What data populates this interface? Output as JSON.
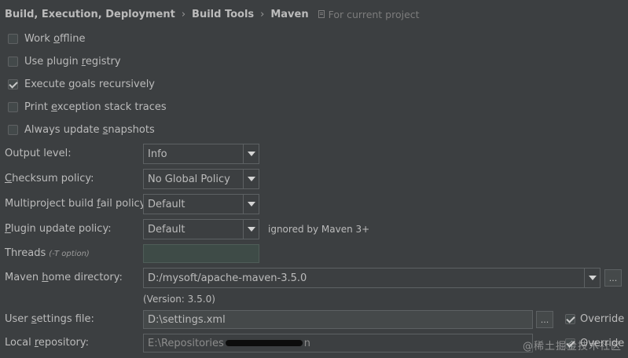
{
  "breadcrumb": {
    "items": [
      "Build, Execution, Deployment",
      "Build Tools",
      "Maven"
    ],
    "separator": "›",
    "scope_label": "For current project",
    "scope_icon": "copy-icon"
  },
  "checkboxes": [
    {
      "pre": "Work ",
      "mnemonic": "o",
      "post": "ffline",
      "checked": false
    },
    {
      "pre": "Use plugin ",
      "mnemonic": "r",
      "post": "egistry",
      "checked": false
    },
    {
      "pre": "Execute ",
      "mnemonic": "g",
      "post": "oals recursively",
      "checked": true
    },
    {
      "pre": "Print ",
      "mnemonic": "e",
      "post": "xception stack traces",
      "checked": false
    },
    {
      "pre": "Always update ",
      "mnemonic": "s",
      "post": "napshots",
      "checked": false
    }
  ],
  "output_level": {
    "label": "Output level:",
    "value": "Info"
  },
  "checksum_policy": {
    "pre": "",
    "mnemonic": "C",
    "post": "hecksum policy:",
    "value": "No Global Policy"
  },
  "multiproject_policy": {
    "pre": "Multiproject build ",
    "mnemonic": "f",
    "post": "ail policy:",
    "value": "Default"
  },
  "plugin_update_policy": {
    "pre": "",
    "mnemonic": "P",
    "post": "lugin update policy:",
    "value": "Default",
    "note": "ignored by Maven 3+"
  },
  "threads": {
    "label": "Threads",
    "hint": "(-T option)",
    "value": ""
  },
  "maven_home": {
    "pre": "Maven ",
    "mnemonic": "h",
    "post": "ome directory:",
    "value": "D:/mysoft/apache-maven-3.5.0",
    "version": "(Version: 3.5.0)",
    "browse": "..."
  },
  "user_settings": {
    "pre": "User ",
    "mnemonic": "s",
    "post": "ettings file:",
    "value": "D:\\settings.xml",
    "browse": "...",
    "override": "Override",
    "override_checked": true
  },
  "local_repo": {
    "pre": "Local ",
    "mnemonic": "r",
    "post": "epository:",
    "value": "E:\\Repositories",
    "value_tail": "n",
    "override": "Override",
    "override_checked": true
  },
  "watermark": "@稀土掘金技术社区",
  "colors": {
    "background": "#3c3f41",
    "text": "#bbbbbb",
    "border": "#5d6163",
    "field": "#45494a"
  }
}
